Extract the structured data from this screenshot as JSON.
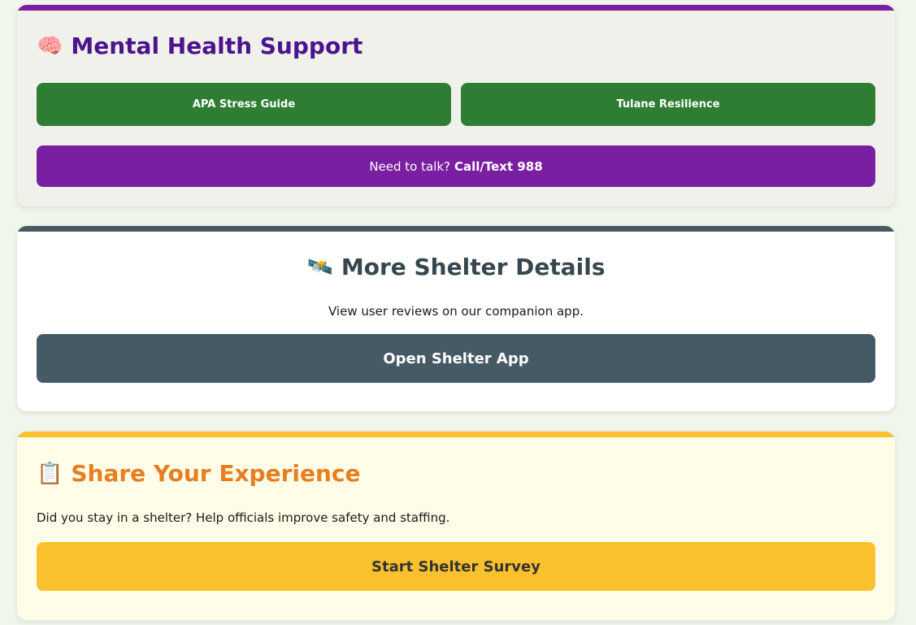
{
  "colors": {
    "page_bg": "#f1f6ec",
    "purple": "#7b1fa2",
    "purple_title": "#4a148c",
    "green": "#2e7d32",
    "slate": "#455a64",
    "slate_title": "#37474f",
    "yellow": "#fbc02d",
    "orange_title": "#e67e22"
  },
  "mental_health": {
    "icon": "brain-icon",
    "emoji": "🧠",
    "title": "Mental Health Support",
    "apa_button": "APA Stress Guide",
    "tulane_button": "Tulane Resilience",
    "talk_prefix": "Need to talk?",
    "talk_action": "Call/Text 988"
  },
  "shelter": {
    "icon": "satellite-icon",
    "emoji": "🛰️",
    "title": "More Shelter Details",
    "description": "View user reviews on our companion app.",
    "button": "Open Shelter App"
  },
  "survey": {
    "icon": "clipboard-icon",
    "emoji": "📋",
    "title": "Share Your Experience",
    "description": "Did you stay in a shelter? Help officials improve safety and staffing.",
    "button": "Start Shelter Survey"
  }
}
